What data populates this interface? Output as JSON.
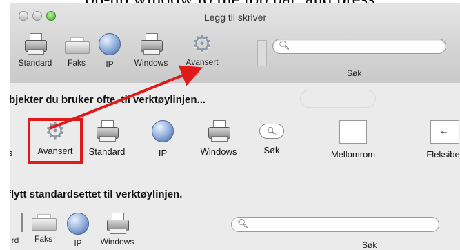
{
  "caption": "op-up window to the top bar, and press",
  "window": {
    "title": "Legg til skriver"
  },
  "toolbar": {
    "items": [
      {
        "label": "Standard",
        "icon": "printer-magnifier-icon"
      },
      {
        "label": "Faks",
        "icon": "fax-icon"
      },
      {
        "label": "IP",
        "icon": "globe-icon"
      },
      {
        "label": "Windows",
        "icon": "printer-icon"
      },
      {
        "label": "Avansert",
        "icon": "gear-icon"
      }
    ],
    "search_label": "Søk"
  },
  "customize": {
    "heading_items": "bjekter du bruker ofte, til verktøylinjen...",
    "palette": [
      {
        "label": "s"
      },
      {
        "label": "Avansert"
      },
      {
        "label": "Standard"
      },
      {
        "label": "IP"
      },
      {
        "label": "Windows"
      },
      {
        "label": "Søk"
      },
      {
        "label": "Mellomrom"
      },
      {
        "label": "Fleksibel"
      }
    ],
    "heading_default": "flytt standardsettet til verktøylinjen.",
    "default_set": [
      {
        "label": "rd"
      },
      {
        "label": "Faks"
      },
      {
        "label": "IP"
      },
      {
        "label": "Windows"
      }
    ],
    "default_search_label": "Søk"
  },
  "annotation": {
    "highlight_color": "#e01a1a",
    "arrow_color": "#e01a1a"
  }
}
